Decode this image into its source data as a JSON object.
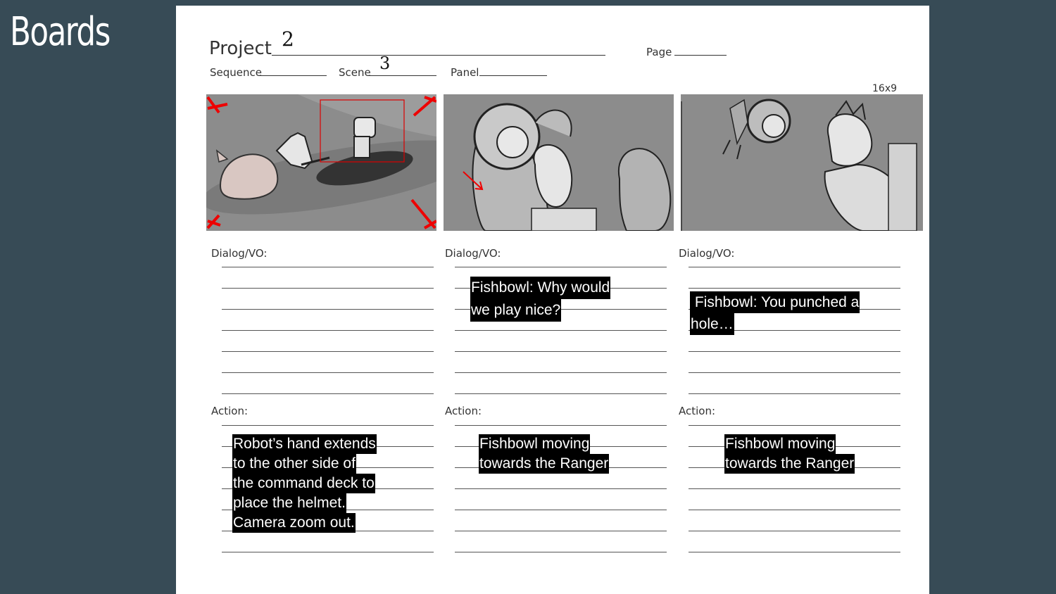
{
  "slide": {
    "title": "Boards"
  },
  "form": {
    "project_label": "Project",
    "project_value": "2",
    "page_label": "Page",
    "sequence_label": "Sequence",
    "scene_label": "Scene",
    "scene_value": "3",
    "panel_label": "Panel",
    "aspect": "16x9"
  },
  "panels": [
    {
      "dialog_label": "Dialog/VO:",
      "dialog": [],
      "action_label": "Action:",
      "action": [
        "Robot’s hand extends",
        "to the other side of",
        "the command deck to",
        "place the helmet.",
        "Camera zoom out."
      ]
    },
    {
      "dialog_label": "Dialog/VO:",
      "dialog": [
        "Fishbowl: Why would",
        "we play nice?"
      ],
      "action_label": "Action:",
      "action": [
        "Fishbowl moving",
        "towards the Ranger"
      ]
    },
    {
      "dialog_label": "Dialog/VO:",
      "dialog": [
        " Fishbowl: You punched a",
        "hole…"
      ],
      "action_label": "Action:",
      "action": [
        "Fishbowl moving",
        "towards the Ranger"
      ]
    }
  ]
}
